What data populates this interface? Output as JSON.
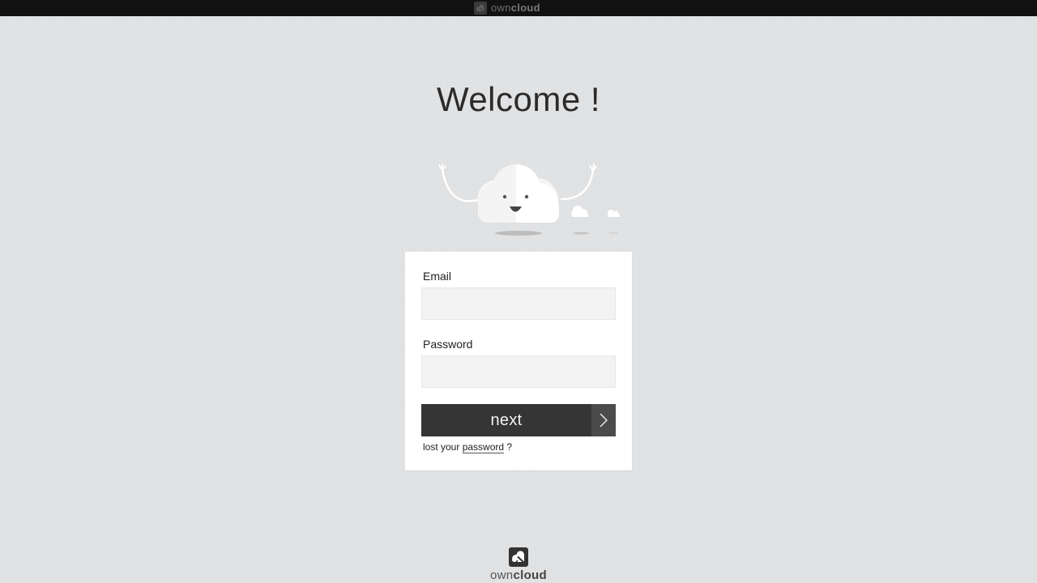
{
  "topbar": {
    "brand_part1": "own",
    "brand_part2": "cloud",
    "logo_icon": "owncloud-logo-icon"
  },
  "welcome": {
    "title": "Welcome !"
  },
  "mascot": {
    "icon": "happy-cloud-mascot-icon"
  },
  "login": {
    "email_label": "Email",
    "email_value": "",
    "password_label": "Password",
    "password_value": "",
    "next_label": "next",
    "next_icon": "chevron-right-icon",
    "lost_prefix": "lost your",
    "lost_link": "password",
    "lost_suffix": "?"
  },
  "footer": {
    "brand_part1": "own",
    "brand_part2": "cloud",
    "logo_icon": "owncloud-logo-icon"
  },
  "colors": {
    "background": "#e3e4e6",
    "topbar": "#111111",
    "button": "#353535",
    "button_arrow": "#4b4b4b",
    "card": "#ffffff",
    "input": "#f3f3f3"
  }
}
